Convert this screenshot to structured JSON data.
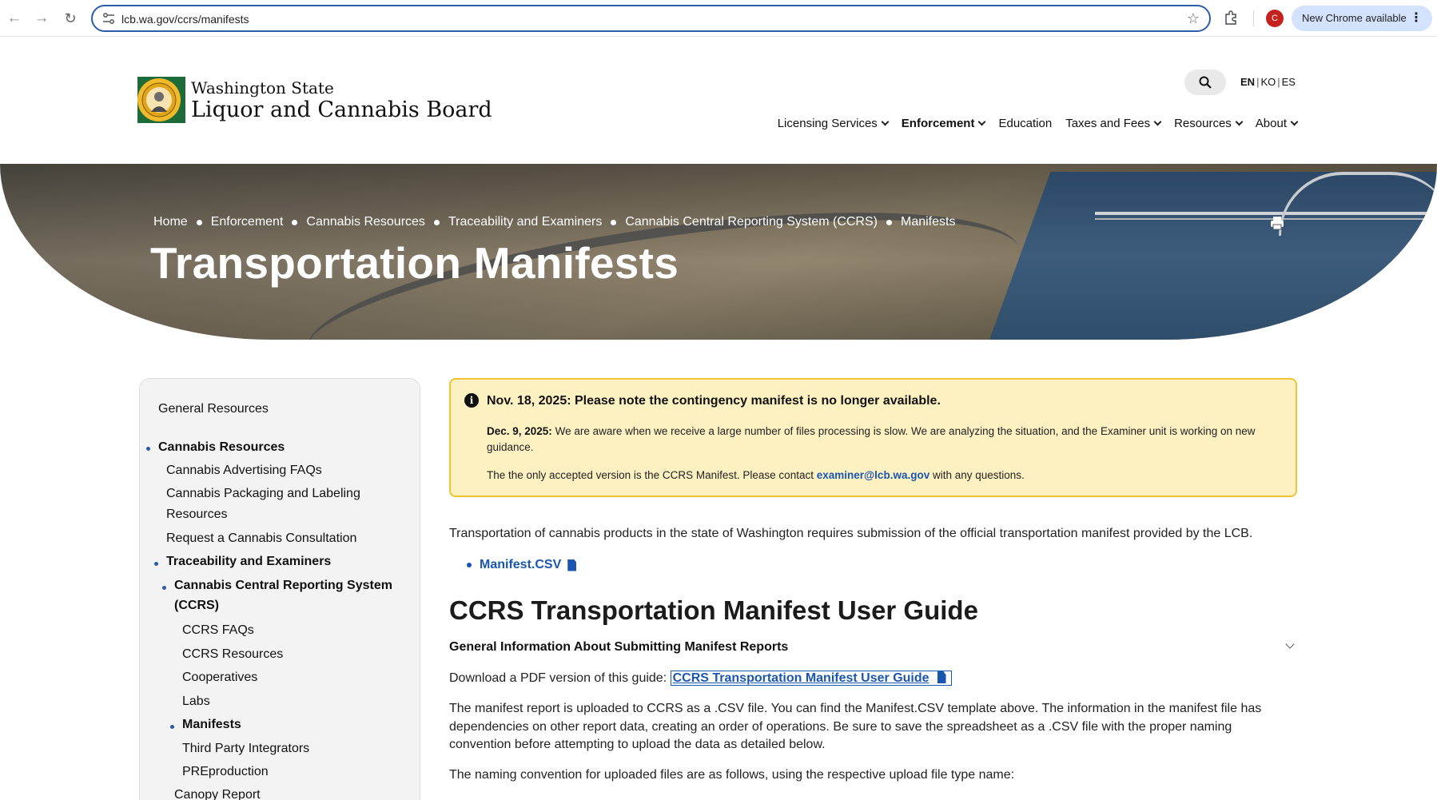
{
  "browser": {
    "url": "lcb.wa.gov/ccrs/manifests",
    "profile_initial": "C",
    "update_label": "New Chrome available"
  },
  "site": {
    "logo_line1": "Washington State",
    "logo_line2": "Liquor and Cannabis Board",
    "languages": [
      "EN",
      "KO",
      "ES"
    ],
    "nav": [
      {
        "label": "Licensing Services",
        "dropdown": true
      },
      {
        "label": "Enforcement",
        "dropdown": true,
        "active": true
      },
      {
        "label": "Education",
        "dropdown": false
      },
      {
        "label": "Taxes and Fees",
        "dropdown": true
      },
      {
        "label": "Resources",
        "dropdown": true
      },
      {
        "label": "About",
        "dropdown": true
      }
    ]
  },
  "hero": {
    "breadcrumb": [
      "Home",
      "Enforcement",
      "Cannabis Resources",
      "Traceability and Examiners",
      "Cannabis Central Reporting System (CCRS)",
      "Manifests"
    ],
    "title": "Transportation Manifests"
  },
  "sidebar": {
    "items": [
      {
        "label": "General Resources"
      },
      {
        "label": "Cannabis Resources"
      },
      {
        "label": "Cannabis Advertising FAQs"
      },
      {
        "label": "Cannabis Packaging and Labeling"
      },
      {
        "label": "Resources"
      },
      {
        "label": "Request a Cannabis Consultation"
      },
      {
        "label": "Traceability and Examiners"
      },
      {
        "label": "Cannabis Central Reporting System"
      },
      {
        "label": "(CCRS)"
      },
      {
        "label": "CCRS FAQs"
      },
      {
        "label": "CCRS Resources"
      },
      {
        "label": "Cooperatives"
      },
      {
        "label": "Labs"
      },
      {
        "label": "Manifests"
      },
      {
        "label": "Third Party Integrators"
      },
      {
        "label": "PREproduction"
      },
      {
        "label": "Canopy Report"
      }
    ]
  },
  "alert": {
    "title": "Nov. 18, 2025: Please note the contingency manifest is no longer available.",
    "p1_date": "Dec. 9, 2025:",
    "p1_text": "We are aware when we receive a large number of files processing is slow. We are analyzing the situation, and the Examiner unit is working on new guidance.",
    "p2_before": "The the only accepted version is the CCRS Manifest. Please contact",
    "p2_email": "examiner@lcb.wa.gov",
    "p2_after": "with any questions."
  },
  "content": {
    "intro": "Transportation of cannabis products in the state of Washington requires submission of the official transportation manifest provided by the LCB.",
    "manifest_link": "Manifest.CSV",
    "h2": "CCRS Transportation Manifest User Guide",
    "accordion_title": "General Information About Submitting Manifest Reports",
    "download_text": "Download a PDF version of this guide:",
    "download_link": "CCRS Transportation Manifest User Guide",
    "para1": "The manifest report is uploaded to CCRS as a .CSV file. You can find the Manifest.CSV template above. The information in the manifest file has dependencies on other report data, creating an order of operations. Be sure to save the spreadsheet as a .CSV file with the proper naming convention before attempting to upload the data as detailed below.",
    "para2": "The naming convention for uploaded files are as follows, using the respective upload file type name:"
  }
}
